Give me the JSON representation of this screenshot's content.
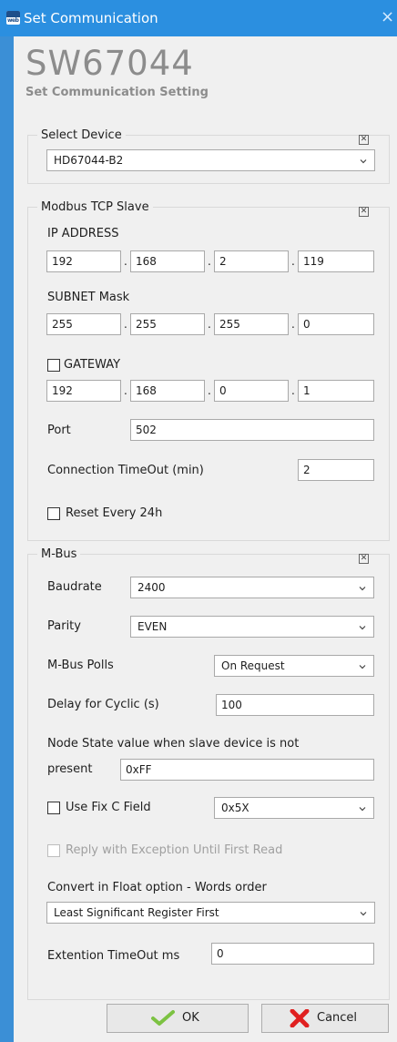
{
  "window": {
    "title": "Set Communication",
    "close_glyph": "×"
  },
  "banner": {
    "title": "SW67044",
    "subtitle": "Set Communication Setting"
  },
  "select_device": {
    "legend": "Select Device",
    "value": "HD67044-B2"
  },
  "modbus": {
    "legend": "Modbus TCP Slave",
    "ip_label": "IP ADDRESS",
    "ip": [
      "192",
      "168",
      "2",
      "119"
    ],
    "subnet_label": "SUBNET Mask",
    "subnet": [
      "255",
      "255",
      "255",
      "0"
    ],
    "gateway_label": "GATEWAY",
    "gateway_checked": false,
    "gateway": [
      "192",
      "168",
      "0",
      "1"
    ],
    "port_label": "Port",
    "port": "502",
    "timeout_label": "Connection TimeOut (min)",
    "timeout": "2",
    "reset_label": "Reset Every 24h",
    "reset_checked": false,
    "dot": "."
  },
  "mbus": {
    "legend": "M-Bus",
    "baudrate_label": "Baudrate",
    "baudrate": "2400",
    "parity_label": "Parity",
    "parity": "EVEN",
    "polls_label": "M-Bus Polls",
    "polls": "On Request",
    "delay_label": "Delay for Cyclic (s)",
    "delay": "100",
    "node_state_line1": "Node State value when slave device is not",
    "node_state_line2": "present",
    "node_state": "0xFF",
    "fixc_label": "Use Fix C Field",
    "fixc_checked": false,
    "fixc": "0x5X",
    "reply_label": "Reply with Exception Until First Read",
    "reply_checked": false,
    "float_label": "Convert in Float option - Words order",
    "float_order": "Least Significant Register First",
    "ext_timeout_label": "Extention TimeOut ms",
    "ext_timeout": "0"
  },
  "buttons": {
    "ok": "OK",
    "cancel": "Cancel"
  },
  "colors": {
    "titlebar": "#2b8fe0",
    "client": "#f0f0f0",
    "ok_check": "#7cc242",
    "cancel_x": "#e02020",
    "banner_text": "#8c8c8c"
  },
  "icons": {
    "app": "app-icon",
    "close": "close-icon",
    "chevron": "chevron-down-icon",
    "ok": "check-icon",
    "cancel": "cross-icon",
    "group_close": "close-box-icon"
  }
}
